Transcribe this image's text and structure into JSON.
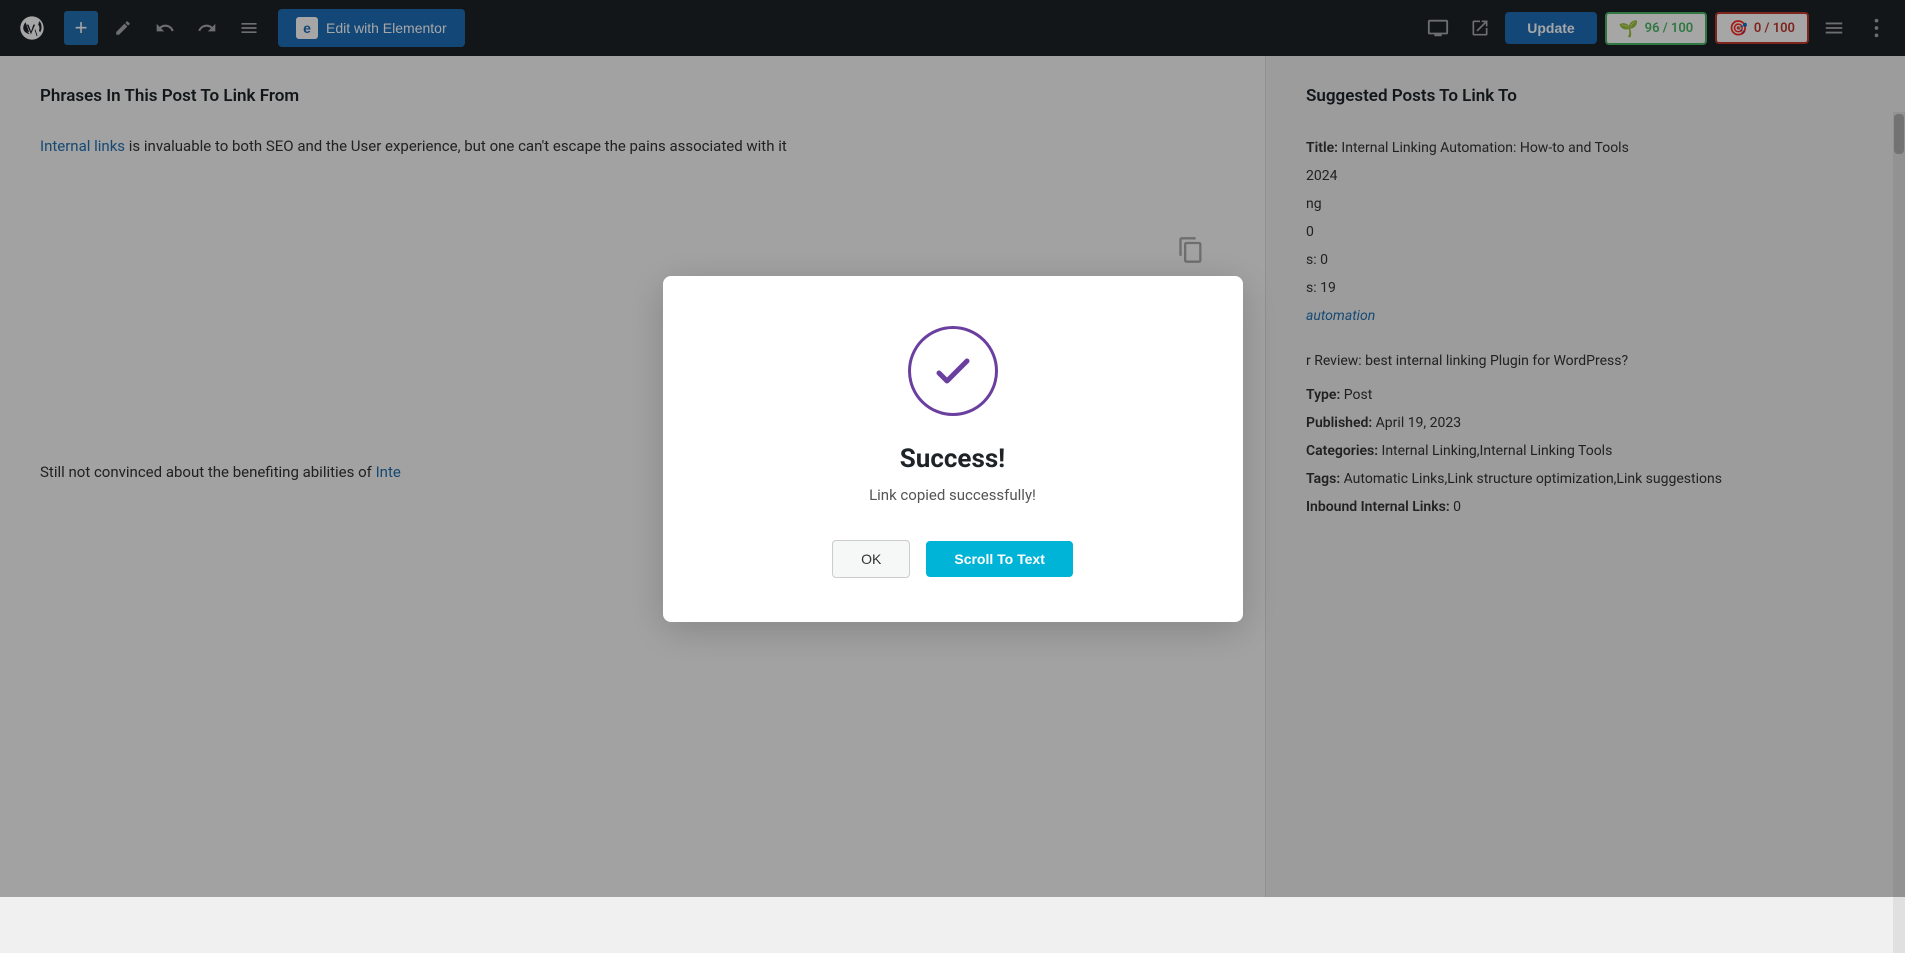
{
  "topbar": {
    "add_label": "+",
    "edit_icon": "✏",
    "undo_icon": "↩",
    "redo_icon": "↪",
    "menu_icon": "≡",
    "elementor_label": "Edit with Elementor",
    "update_label": "Update",
    "score_green_label": "96 / 100",
    "score_red_label": "0 / 100"
  },
  "left_panel": {
    "title": "Phrases In This Post To Link From",
    "paragraph1_before": "Internal links",
    "paragraph1_link": "Internal links",
    "paragraph1_after": " is invaluable to both SEO and the User experience, but one can't escape the pains associated with it",
    "paragraph2_before": "Still not convinced about the benefiting abilities of ",
    "paragraph2_link": "Inte"
  },
  "right_panel": {
    "title": "Suggested Posts To Link To",
    "post_title_label": "Title:",
    "post_title_value": "Internal Linking Automation: How-to and Tools",
    "year": "2024",
    "status_partial": "ng",
    "links_count": "0",
    "label_s1": "s: 0",
    "label_s2": "s: 19",
    "automation_link": "automation",
    "second_post_partial": "r Review: best internal linking Plugin for WordPress?",
    "type_label": "Type:",
    "type_value": "Post",
    "published_label": "Published:",
    "published_value": "April 19, 2023",
    "categories_label": "Categories:",
    "categories_value": "Internal Linking,Internal Linking Tools",
    "tags_label": "Tags:",
    "tags_value": "Automatic Links,Link structure optimization,Link suggestions",
    "inbound_label": "Inbound Internal Links:",
    "inbound_value": "0"
  },
  "modal": {
    "title": "Success!",
    "subtitle": "Link copied successfully!",
    "ok_label": "OK",
    "scroll_label": "Scroll To Text"
  }
}
